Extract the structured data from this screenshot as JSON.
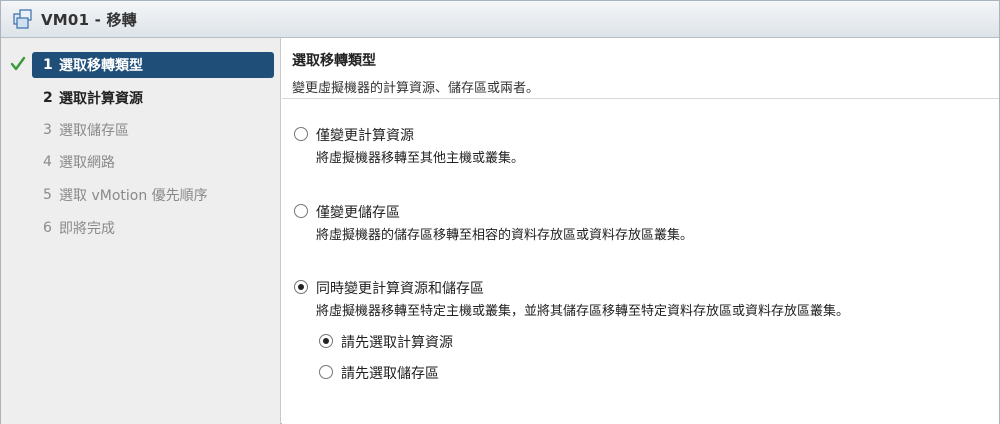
{
  "window": {
    "title": "VM01 - 移轉",
    "icon": "vm-migrate-icon"
  },
  "nav": {
    "steps": [
      {
        "num": "1",
        "label": "選取移轉類型",
        "state": "active",
        "completed": true
      },
      {
        "num": "2",
        "label": "選取計算資源",
        "state": "current",
        "completed": false
      },
      {
        "num": "3",
        "label": "選取儲存區",
        "state": "pending",
        "completed": false
      },
      {
        "num": "4",
        "label": "選取網路",
        "state": "pending",
        "completed": false
      },
      {
        "num": "5",
        "label": "選取 vMotion 優先順序",
        "state": "pending",
        "completed": false
      },
      {
        "num": "6",
        "label": "即將完成",
        "state": "pending",
        "completed": false
      }
    ]
  },
  "main": {
    "title": "選取移轉類型",
    "subtitle": "變更虛擬機器的計算資源、儲存區或兩者。",
    "options": [
      {
        "label": "僅變更計算資源",
        "description": "將虛擬機器移轉至其他主機或叢集。",
        "checked": false
      },
      {
        "label": "僅變更儲存區",
        "description": "將虛擬機器的儲存區移轉至相容的資料存放區或資料存放區叢集。",
        "checked": false
      },
      {
        "label": "同時變更計算資源和儲存區",
        "description": "將虛擬機器移轉至特定主機或叢集，並將其儲存區移轉至特定資料存放區或資料存放區叢集。",
        "checked": true
      }
    ],
    "suboptions": [
      {
        "label": "請先選取計算資源",
        "checked": true
      },
      {
        "label": "請先選取儲存區",
        "checked": false
      }
    ]
  },
  "colors": {
    "active_step_bg": "#1f4e79",
    "check_green": "#3a9a3a",
    "pending_text": "#8a8a8a"
  }
}
